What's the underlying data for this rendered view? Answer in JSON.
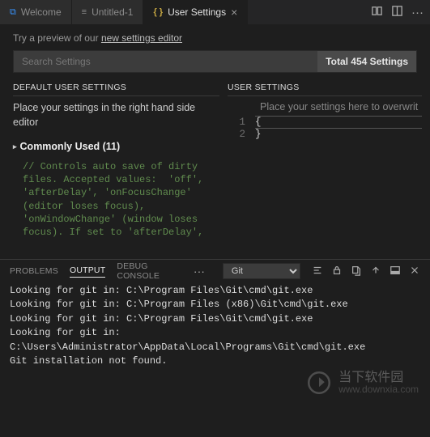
{
  "tabs": {
    "welcome": "Welcome",
    "untitled": "Untitled-1",
    "settings": "User Settings"
  },
  "preview": {
    "prefix": "Try a preview of our ",
    "link": "new settings editor"
  },
  "search": {
    "placeholder": "Search Settings",
    "count": "Total 454 Settings"
  },
  "left": {
    "header": "DEFAULT USER SETTINGS",
    "hint": "Place your settings in the right hand side editor",
    "group": "Commonly Used (11)",
    "comment": "// Controls auto save of dirty\nfiles. Accepted values:  'off',\n'afterDelay', 'onFocusChange'\n(editor loses focus),\n'onWindowChange' (window loses\nfocus). If set to 'afterDelay',"
  },
  "right": {
    "header": "USER SETTINGS",
    "hint": "Place your settings here to overwrit",
    "line1": "{",
    "line2": "}",
    "ln1": "1",
    "ln2": "2"
  },
  "panel": {
    "tabs": {
      "problems": "PROBLEMS",
      "output": "OUTPUT",
      "debug": "DEBUG CONSOLE"
    },
    "more": "···",
    "select_value": "Git",
    "body": "Looking for git in: C:\\Program Files\\Git\\cmd\\git.exe\nLooking for git in: C:\\Program Files (x86)\\Git\\cmd\\git.exe\nLooking for git in: C:\\Program Files\\Git\\cmd\\git.exe\nLooking for git in:\nC:\\Users\\Administrator\\AppData\\Local\\Programs\\Git\\cmd\\git.exe\nGit installation not found."
  },
  "watermark": {
    "main": "当下软件园",
    "sub": "www.downxia.com"
  }
}
